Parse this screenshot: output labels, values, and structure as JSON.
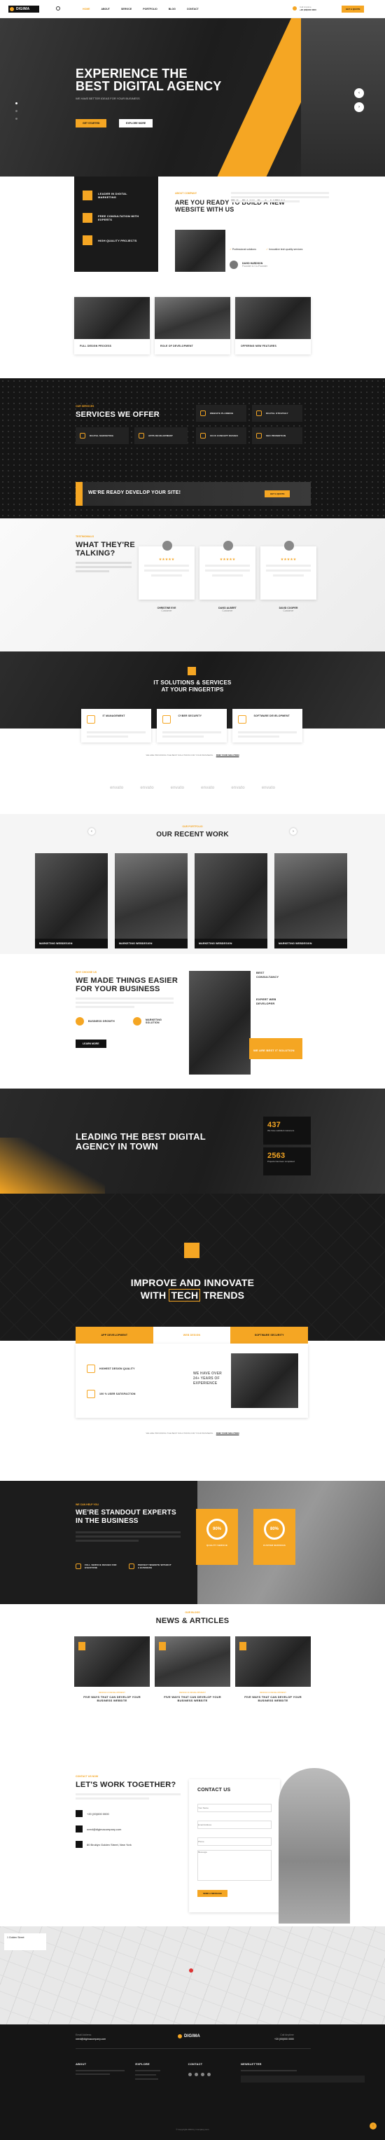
{
  "nav": {
    "logo": "DIGIMA",
    "items": [
      "HOME",
      "ABOUT",
      "SERVICE",
      "PORTFOLIO",
      "BLOG",
      "CONTACT"
    ],
    "phone_label": "Call Anytime",
    "phone": "+20 (00)000 0000",
    "cta": "GET A QUOTE"
  },
  "hero": {
    "title1": "EXPERIENCE THE",
    "title2": "BEST DIGITAL AGENCY",
    "text": "WE HAVE BETTER IDEAS FOR YOUR BUSINESS",
    "btn1": "GET STARTED",
    "btn2": "EXPLORE MORE",
    "dots": [
      "01",
      "02",
      "03"
    ]
  },
  "features": [
    {
      "label": "LEADER IN DIGITAL MARKETING"
    },
    {
      "label": "FREE CONSULTATION WITH EXPERTS"
    },
    {
      "label": "HIGH QUALITY PROJECTS"
    }
  ],
  "about": {
    "tag": "ABOUT COMPANY",
    "title": "ARE YOU READY TO BUILD A NEW WEBSITE WITH US",
    "check1": "Professional solutions",
    "check2": "Innovative tech quality services",
    "name": "DAVID HARDSON",
    "role": "Founder & Co-Founder"
  },
  "projects": [
    {
      "label": "FULL DESIGN PROCESS"
    },
    {
      "label": "ROLE OF DEVELOPMENT"
    },
    {
      "label": "OFFERING NEW FEATURES"
    }
  ],
  "services": {
    "tag": "OUR SERVICES",
    "title": "SERVICES WE OFFER",
    "items": [
      "WEBSITE PLANNING",
      "DIGITAL STRATEGY",
      "DIGITAL MARKETING",
      "APPS DEVELOPMENT",
      "UI/UX CONCEPT DESIGN",
      "SEO PROMOTION"
    ],
    "banner": "WE'RE READY DEVELOP YOUR SITE!",
    "banner_btn": "GET A QUOTE"
  },
  "testimonials": {
    "tag": "TESTIMONIALS",
    "title1": "WHAT THEY'RE",
    "title2": "TALKING?",
    "people": [
      {
        "name": "CHRISTINE EVE",
        "role": "Customer"
      },
      {
        "name": "DAVID ALBERT",
        "role": "Customer"
      },
      {
        "name": "DAVID COOPER",
        "role": "Customer"
      }
    ]
  },
  "solutions": {
    "title1": "IT SOLUTIONS & SERVICES",
    "title2": "AT YOUR FINGERTIPS",
    "items": [
      "IT MANAGEMENT",
      "CYBER SECURITY",
      "SOFTWARE DEVELOPMENT"
    ],
    "note": "WE ARE PROVIDING THE BEST SOLUTIONS FOR YOUR BUSINESS.",
    "link": "FIND YOUR SOLUTION"
  },
  "brands": [
    "envato",
    "envato",
    "envato",
    "envato",
    "envato",
    "envato"
  ],
  "work": {
    "tag": "OUR PORTFOLIO",
    "title": "OUR RECENT WORK",
    "items": [
      "MARKETING WEBDESIGN",
      "MARKETING WEBDESIGN",
      "MARKETING WEBDESIGN",
      "MARKETING WEBDESIGN"
    ]
  },
  "easier": {
    "tag": "WHY CHOOSE US",
    "title1": "WE MADE THINGS EASIER",
    "title2": "FOR YOUR BUSINESS",
    "p1": "BUSINESS GROWTH",
    "p2": "MARKETING SOLUTION",
    "btn": "LEARN MORE",
    "side1": "BEST CONSULTANCY",
    "side2": "EXPERT WEB DEVELOPER",
    "side_badge": "WE ARE BEST IT SOLUTION COMPANY"
  },
  "leading": {
    "title1": "LEADING THE BEST DIGITAL",
    "title2": "AGENCY IN TOWN",
    "stat1": "437",
    "stat1_label": "We have satisfied customers",
    "stat2": "2563",
    "stat2_label": "Projects has been completed"
  },
  "improve": {
    "title1": "IMPROVE AND INNOVATE",
    "title2a": "WITH ",
    "title2b": "TECH",
    "title2c": " TRENDS",
    "tabs": [
      "APP DEVELOPMENT",
      "WEB DESIGN",
      "SOFTWARE SECURITY"
    ],
    "i1": "HIGHEST DESIGN QUALITY",
    "i2": "100 % USER SATISFACTION",
    "years": "WE HAVE OVER 24+ YEARS OF EXPERIENCE",
    "note": "WE ARE PROVIDING THE BEST SOLUTIONS FOR YOUR BUSINESS.",
    "link": "FIND YOUR SOLUTION"
  },
  "experts": {
    "tag": "WE CAN HELP YOU",
    "title1": "WE'RE STANDOUT EXPERTS",
    "title2": "IN THE BUSINESS",
    "f1": "FULL SERVICE DESIGN FOR EVERYONE",
    "f2": "PERFECT WEBSITE WITHOUT A BUSINESS",
    "c1": "90%",
    "c1_label": "QUALITY SERVICE",
    "c2": "80%",
    "c2_label": "CUSTOM SERVICES"
  },
  "news": {
    "tag": "OUR BLOGS",
    "title": "NEWS & ARTICLES",
    "posts": [
      {
        "cat": "DESIGN & DEVELOPMENT",
        "title": "FIVE WAYS THAT CAN DEVELOP YOUR BUSINESS WEBSITE"
      },
      {
        "cat": "DESIGN & DEVELOPMENT",
        "title": "FIVE WAYS THAT CAN DEVELOP YOUR BUSINESS WEBSITE"
      },
      {
        "cat": "DESIGN & DEVELOPMENT",
        "title": "FIVE WAYS THAT CAN DEVELOP YOUR BUSINESS WEBSITE"
      }
    ]
  },
  "contact": {
    "tag": "CONTACT US NOW",
    "title": "LET'S WORK TOGETHER?",
    "phone": "+20 (00)000 0000",
    "email": "need@digimacompany.com",
    "address": "80 Broklyn Golden Street, New York",
    "form_title": "CONTACT US",
    "fields": [
      "Your Name",
      "Email Address",
      "Phone",
      "Message"
    ],
    "btn": "SEND A MESSAGE"
  },
  "footer": {
    "email_label": "Email Address",
    "email": "need@digimacompany.com",
    "logo": "DIGIMA",
    "phone_label": "Call Anytime",
    "phone": "+20 (00)000 0000",
    "cols": [
      "ABOUT",
      "EXPLORE",
      "CONTACT",
      "NEWSLETTER"
    ],
    "copy": "© Copyright 2023 by Company.com"
  },
  "map": {
    "label": "1 Golden Street"
  },
  "colors": {
    "accent": "#f5a623",
    "dark": "#1a1a1a"
  }
}
